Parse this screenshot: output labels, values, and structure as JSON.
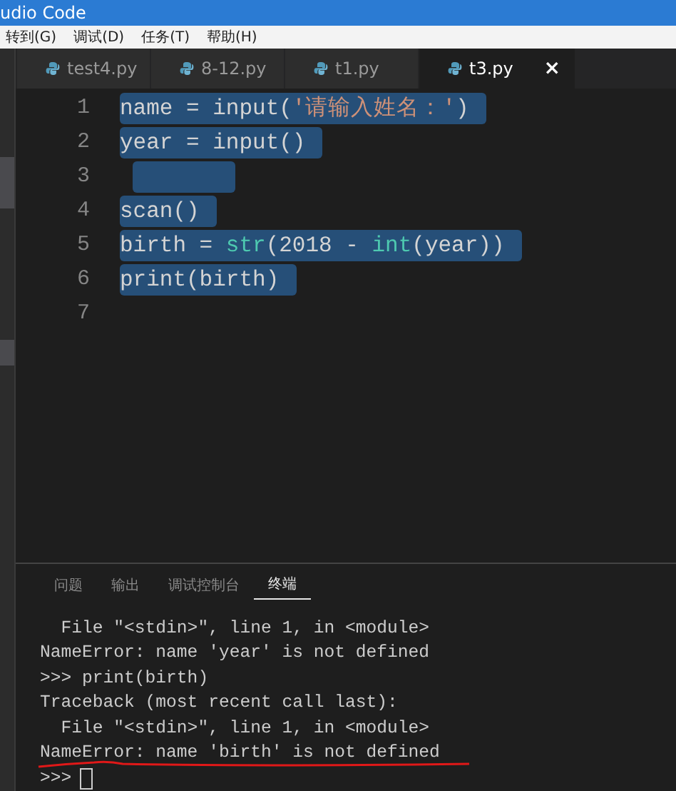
{
  "window": {
    "title": "udio Code"
  },
  "menu": [
    "转到(G)",
    "调试(D)",
    "任务(T)",
    "帮助(H)"
  ],
  "tabs": [
    {
      "label": "test4.py",
      "selected": false
    },
    {
      "label": "8-12.py",
      "selected": false
    },
    {
      "label": "t1.py",
      "selected": false
    },
    {
      "label": "t3.py",
      "selected": true,
      "close": "×"
    }
  ],
  "editor": {
    "lines": [
      {
        "number": "1",
        "selected": true,
        "tokens": [
          {
            "kind": "plain",
            "text": "name = input("
          },
          {
            "kind": "string",
            "text": "'请输入姓名：'"
          },
          {
            "kind": "plain",
            "text": ")"
          }
        ]
      },
      {
        "number": "2",
        "selected": true,
        "tokens": [
          {
            "kind": "plain",
            "text": "year = input()"
          }
        ]
      },
      {
        "number": "3",
        "selected": true
      },
      {
        "number": "4",
        "selected": true,
        "tokens": [
          {
            "kind": "plain",
            "text": "scan()"
          }
        ]
      },
      {
        "number": "5",
        "selected": true,
        "tokens": [
          {
            "kind": "plain",
            "text": "birth = "
          },
          {
            "kind": "builtin",
            "text": "str"
          },
          {
            "kind": "plain",
            "text": "(2018 - "
          },
          {
            "kind": "builtin",
            "text": "int"
          },
          {
            "kind": "plain",
            "text": "(year))"
          }
        ]
      },
      {
        "number": "6",
        "selected": true,
        "tokens": [
          {
            "kind": "plain",
            "text": "print(birth)"
          }
        ]
      },
      {
        "number": "7",
        "selected": false
      }
    ]
  },
  "panel": {
    "tabs": [
      {
        "label": "问题",
        "selected": false
      },
      {
        "label": "输出",
        "selected": false
      },
      {
        "label": "调试控制台",
        "selected": false
      },
      {
        "label": "终端",
        "selected": true
      }
    ],
    "terminal": [
      {
        "text": "  File \"<stdin>\", line 1, in <module>",
        "underlined": false
      },
      {
        "text": "NameError: name 'year' is not defined",
        "underlined": false
      },
      {
        "text": ">>> print(birth)",
        "underlined": false
      },
      {
        "text": "Traceback (most recent call last):",
        "underlined": false
      },
      {
        "text": "  File \"<stdin>\", line 1, in <module>",
        "underlined": false
      },
      {
        "text": "NameError: name 'birth' is not defined",
        "underlined": true
      }
    ],
    "prompt": ">>>"
  }
}
